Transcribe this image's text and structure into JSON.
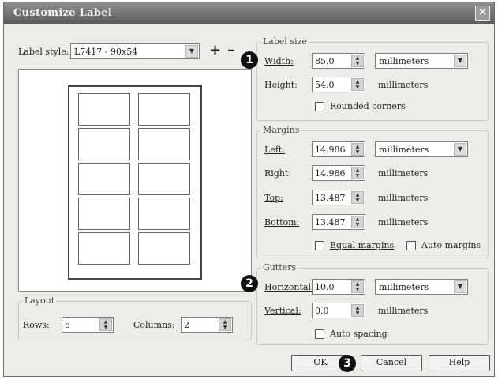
{
  "window": {
    "title": "Customize Label",
    "close_glyph": "✕"
  },
  "label_style": {
    "label": "Label style:",
    "value": "L7417 - 90x54",
    "add_glyph": "+",
    "remove_glyph": "–"
  },
  "preview": {
    "rows": 5,
    "columns": 2
  },
  "layout": {
    "title": "Layout",
    "rows_label": "Rows:",
    "rows_value": "5",
    "columns_label": "Columns:",
    "columns_value": "2"
  },
  "label_size": {
    "title": "Label size",
    "width_label": "Width:",
    "width_value": "85.0",
    "width_unit": "millimeters",
    "height_label": "Height:",
    "height_value": "54.0",
    "height_unit": "millimeters",
    "rounded_label": "Rounded corners"
  },
  "margins": {
    "title": "Margins",
    "left_label": "Left:",
    "left_value": "14.986",
    "left_unit": "millimeters",
    "right_label": "Right:",
    "right_value": "14.986",
    "right_unit": "millimeters",
    "top_label": "Top:",
    "top_value": "13.487",
    "top_unit": "millimeters",
    "bottom_label": "Bottom:",
    "bottom_value": "13.487",
    "bottom_unit": "millimeters",
    "equal_label": "Equal margins",
    "auto_label": "Auto margins"
  },
  "gutters": {
    "title": "Gutters",
    "horizontal_label": "Horizontal:",
    "horizontal_value": "10.0",
    "horizontal_unit": "millimeters",
    "vertical_label": "Vertical:",
    "vertical_value": "0.0",
    "vertical_unit": "millimeters",
    "auto_label": "Auto spacing"
  },
  "buttons": {
    "ok": "OK",
    "cancel": "Cancel",
    "help": "Help"
  },
  "markers": {
    "one": "1",
    "two": "2",
    "three": "3"
  },
  "icons": {
    "dropdown": "▼",
    "spin_up": "▲",
    "spin_down": "▼"
  }
}
